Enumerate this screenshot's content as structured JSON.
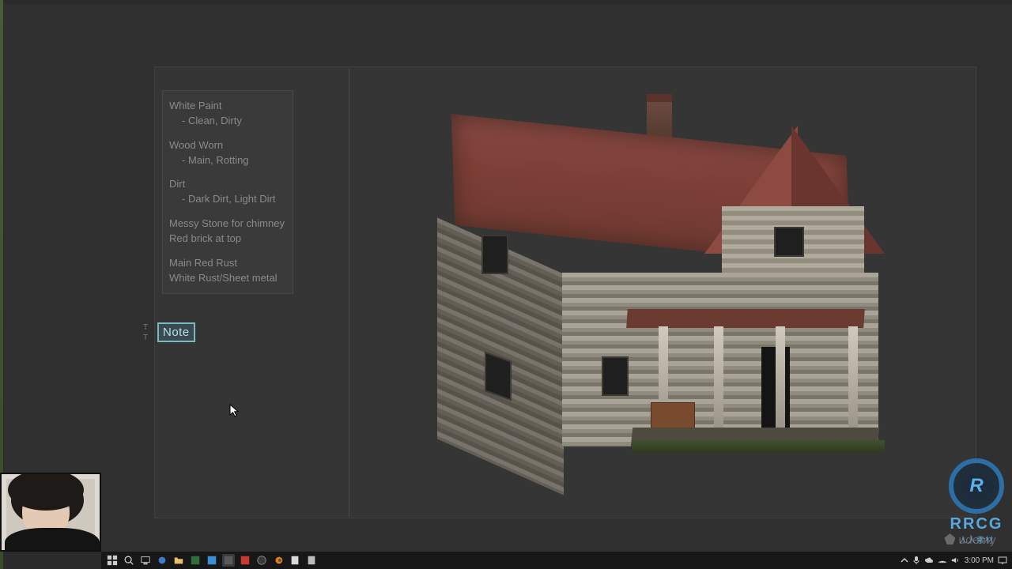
{
  "notes": {
    "l1": "White Paint",
    "l1s": "- Clean, Dirty",
    "l2": "Wood Worn",
    "l2s": "- Main, Rotting",
    "l3": "Dirt",
    "l3s": "- Dark Dirt, Light Dirt",
    "l4a": "Messy Stone for chimney",
    "l4b": "Red brick at top",
    "l5a": "Main Red Rust",
    "l5b": "White Rust/Sheet metal"
  },
  "note_tag": "Note",
  "t_handle": "T",
  "taskbar": {
    "time": "3:00 PM"
  },
  "watermark": {
    "udemy": "udemy",
    "rrcg_logo": "R",
    "rrcg_text": "RRCG",
    "rrcg_sub": "人人素材"
  }
}
